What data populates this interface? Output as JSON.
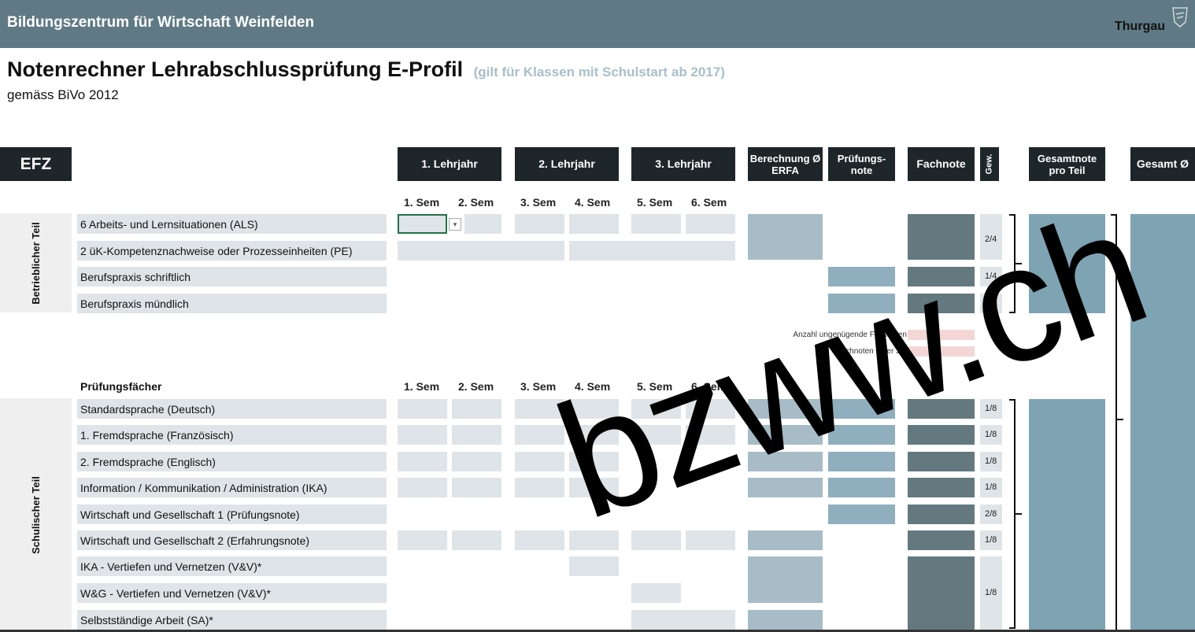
{
  "header": {
    "school": "Bildungszentrum für Wirtschaft Weinfelden",
    "brand": "Thurgau"
  },
  "title": {
    "main": "Notenrechner Lehrabschlussprüfung E-Profil",
    "note": "(gilt für Klassen mit Schulstart ab 2017)",
    "sub": "gemäss BiVo 2012"
  },
  "columns": {
    "efz": "EFZ",
    "year1": "1. Lehrjahr",
    "year2": "2. Lehrjahr",
    "year3": "3. Lehrjahr",
    "berechnung": "Berechnung Ø ERFA",
    "pruefung": "Prüfungs-note",
    "fachnote": "Fachnote",
    "gew": "Gew.",
    "gesamtteil": "Gesamtnote pro Teil",
    "gesamt": "Gesamt Ø"
  },
  "semesters": [
    "1. Sem",
    "2. Sem",
    "3. Sem",
    "4. Sem",
    "5. Sem",
    "6. Sem"
  ],
  "betrieb": {
    "side_label": "Betrieblicher Teil",
    "rows": [
      "6 Arbeits- und Lernsituationen (ALS)",
      "2 üK-Kompetenznachweise oder Prozesseinheiten (PE)",
      "Berufspraxis schriftlich",
      "Berufspraxis mündlich"
    ],
    "weights": [
      "2/4",
      "1/4",
      "1/4"
    ]
  },
  "summary": {
    "ungenuegend": "Anzahl ungenügende Fachnoten",
    "unter3": "Fachnoten unter 3.0"
  },
  "schule": {
    "heading": "Prüfungsfächer",
    "side_label": "Schulischer Teil",
    "rows": [
      "Standardsprache (Deutsch)",
      "1. Fremdsprache (Französisch)",
      "2. Fremdsprache (Englisch)",
      "Information / Kommunikation / Administration (IKA)",
      "Wirtschaft und Gesellschaft 1 (Prüfungsnote)",
      "Wirtschaft und Gesellschaft 2 (Erfahrungsnote)",
      "IKA - Vertiefen und Vernetzen (V&V)*",
      "W&G - Vertiefen und Vernetzen (V&V)*",
      "Selbstständige Arbeit (SA)*"
    ],
    "weights": [
      "1/8",
      "1/8",
      "1/8",
      "1/8",
      "2/8",
      "1/8",
      "1/8"
    ]
  },
  "watermark": "bzww.ch"
}
